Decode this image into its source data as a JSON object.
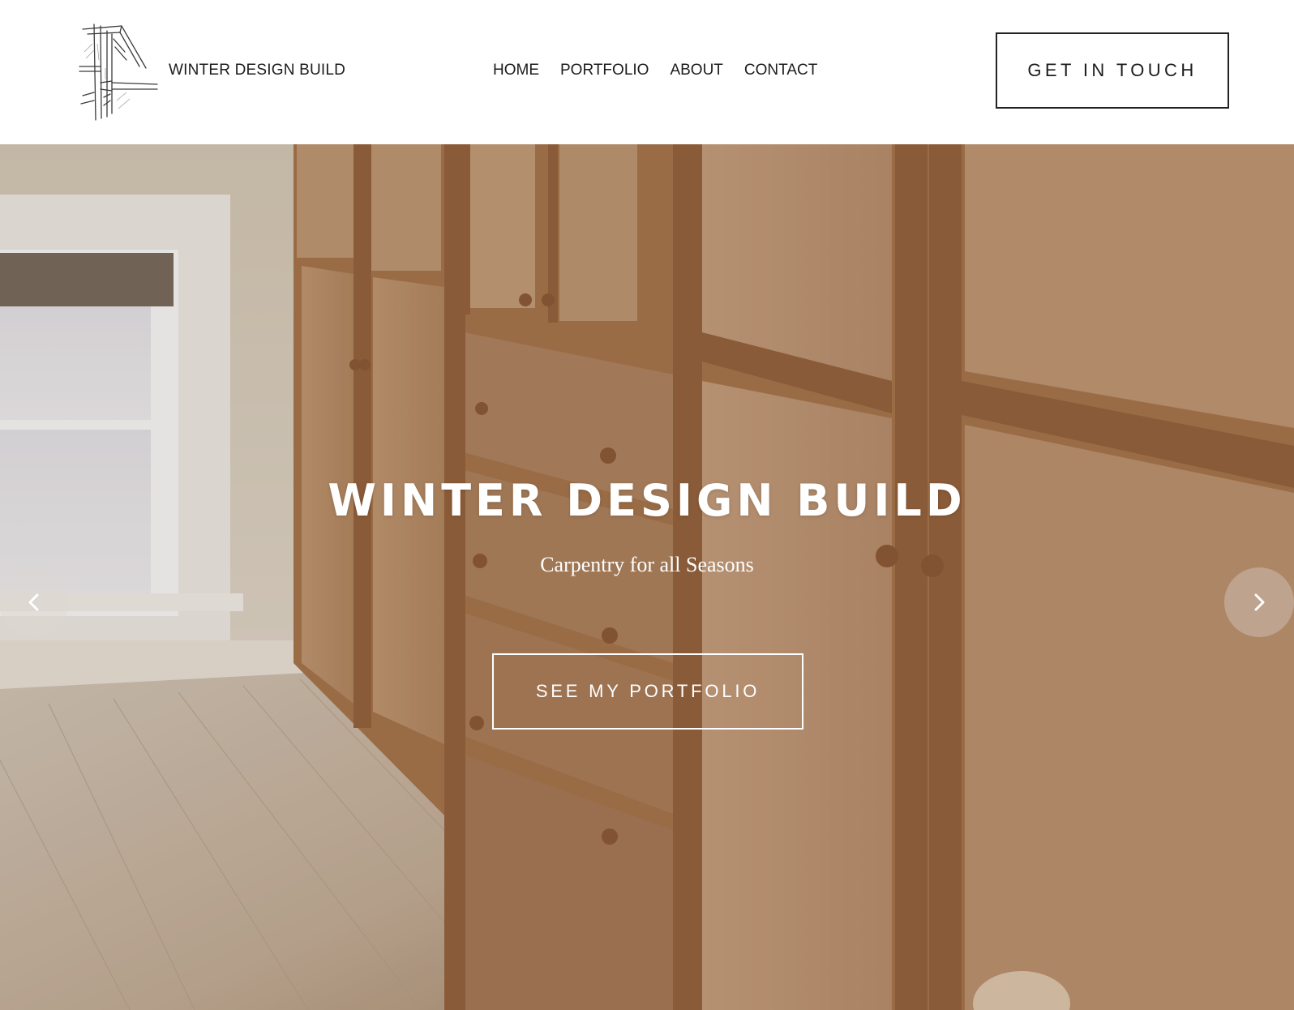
{
  "header": {
    "brand_name": "WINTER DESIGN BUILD",
    "logo_icon": "timber-frame-sketch-icon",
    "nav": [
      {
        "label": "HOME"
      },
      {
        "label": "PORTFOLIO"
      },
      {
        "label": "ABOUT"
      },
      {
        "label": "CONTACT"
      }
    ],
    "cta_label": "GET IN TOUCH"
  },
  "hero": {
    "title": "WINTER DESIGN BUILD",
    "subtitle": "Carpentry for all Seasons",
    "button_label": "SEE MY PORTFOLIO",
    "prev_icon": "chevron-left-icon",
    "next_icon": "chevron-right-icon",
    "background_image": "built-in wood cabinets and drawers beside a window, maple floor"
  },
  "colors": {
    "header_bg": "#ffffff",
    "text_dark": "#1c1c1c",
    "hero_text": "#ffffff",
    "wood": "#b98c68"
  }
}
